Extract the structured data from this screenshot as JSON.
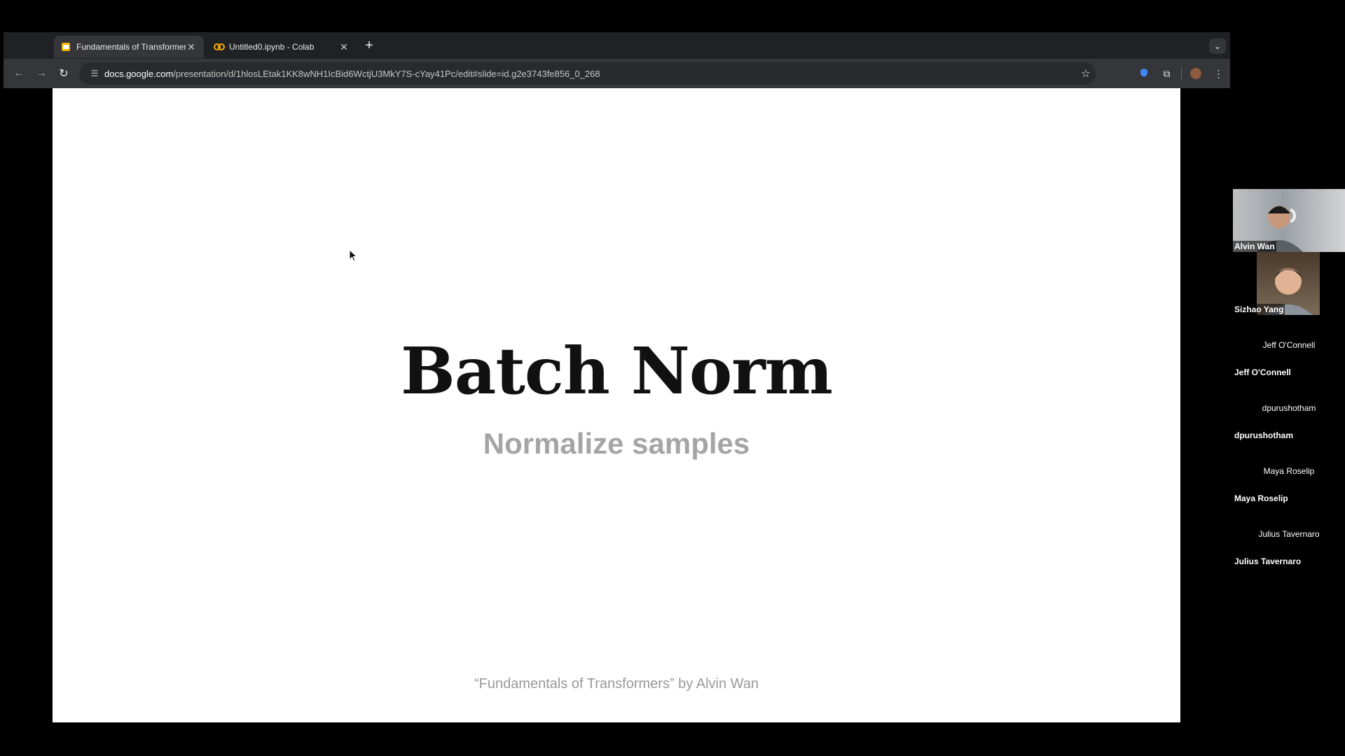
{
  "browser": {
    "tabs": [
      {
        "title": "Fundamentals of Transformers",
        "active": true,
        "favicon": "slides-icon"
      },
      {
        "title": "Untitled0.ipynb - Colab",
        "active": false,
        "favicon": "colab-icon"
      }
    ],
    "url_host": "docs.google.com",
    "url_path": "/presentation/d/1hlosLEtak1KK8wNH1IcBid6WctjU3MkY7S-cYay41Pc/edit#slide=id.g2e3743fe856_0_268"
  },
  "slide": {
    "title": "Batch Norm",
    "subtitle": "Normalize samples",
    "footer": "“Fundamentals of Transformers” by Alvin Wan"
  },
  "participants": [
    {
      "name": "Alvin Wan",
      "video": true
    },
    {
      "name": "Sizhao Yang",
      "video": true
    },
    {
      "name": "Jeff O'Connell",
      "video": false
    },
    {
      "name": "dpurushotham",
      "video": false
    },
    {
      "name": "Maya Roselip",
      "video": false
    },
    {
      "name": "Julius Tavernaro",
      "video": false
    }
  ],
  "colors": {
    "slides_favicon": "#f4b400",
    "colab_favicon": "#f9ab00",
    "chrome_bg": "#202124",
    "toolbar_bg": "#35363a"
  }
}
